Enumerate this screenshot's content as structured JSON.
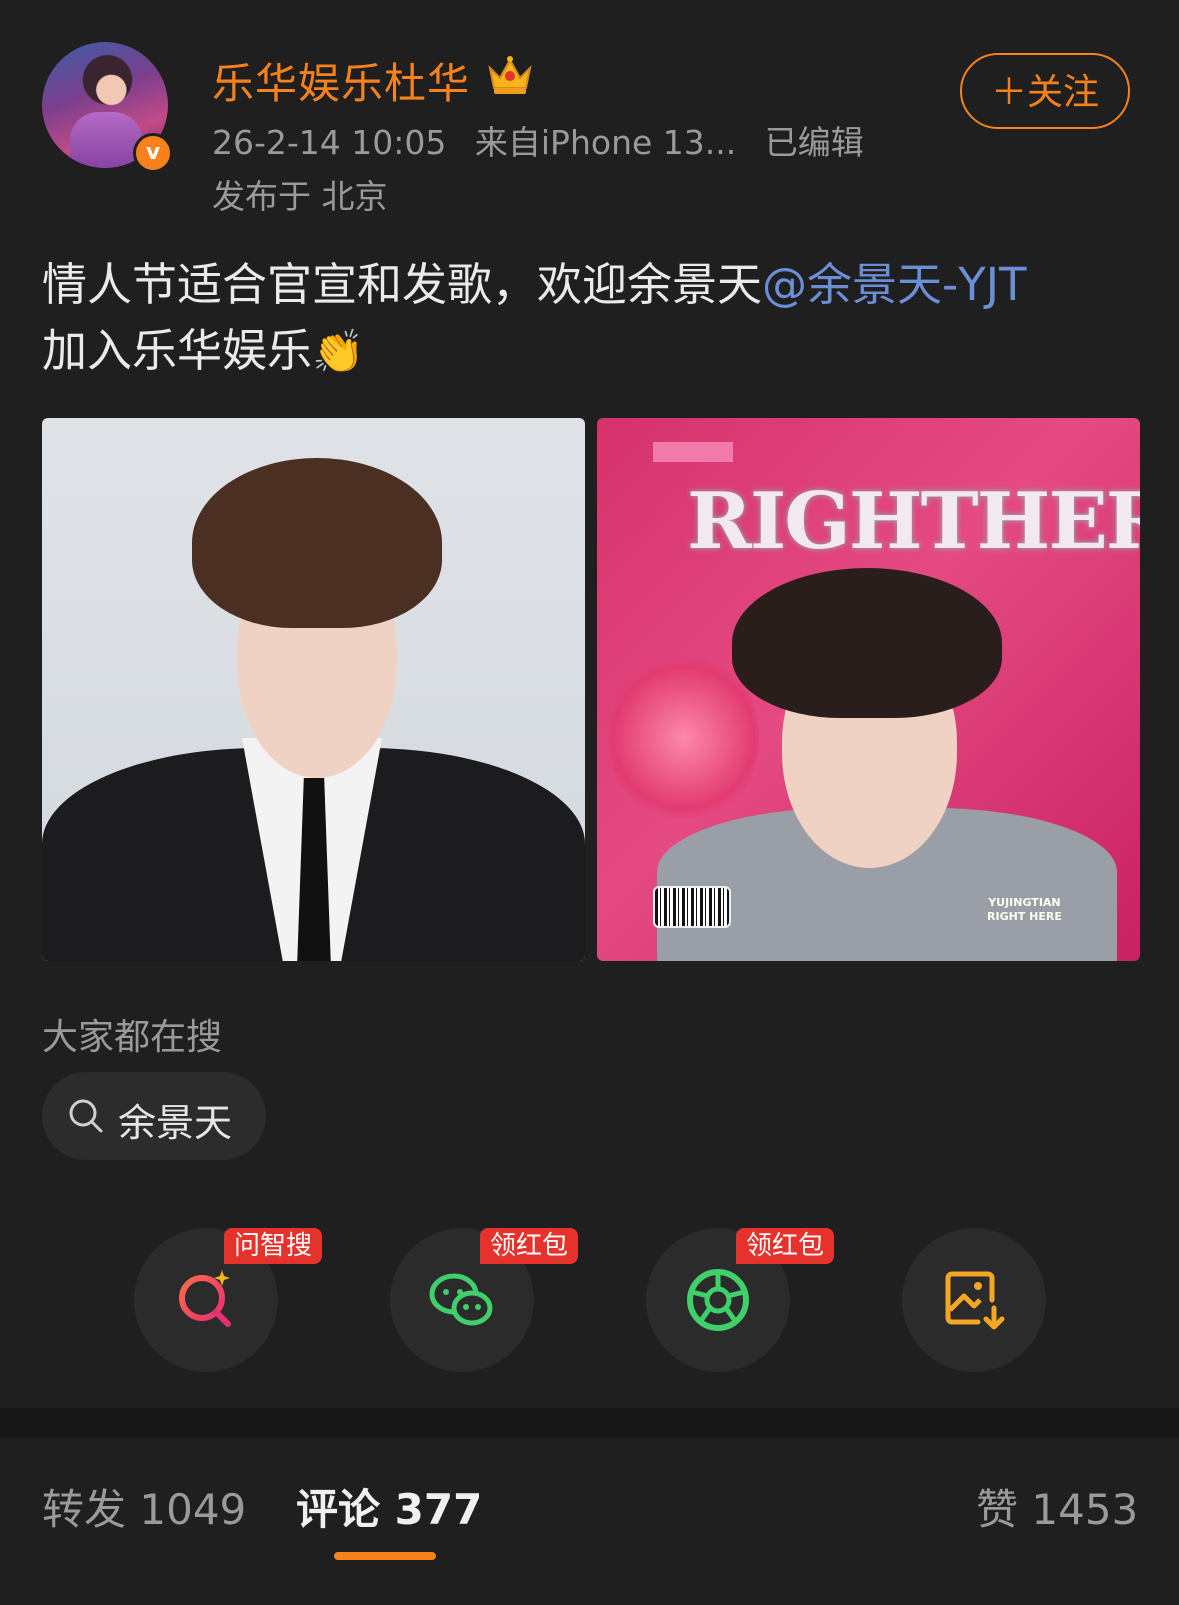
{
  "header": {
    "username": "乐华娱乐杜华",
    "avatar_badge": "v",
    "timestamp": "26-2-14 10:05",
    "source": "来自iPhone 13...",
    "edited": "已编辑",
    "location": "发布于 北京",
    "follow_label": "＋关注"
  },
  "post": {
    "text": "情人节适合官宣和发歌，欢迎余景天",
    "mention": "@余景天-YJT",
    "text2": "加入乐华娱乐",
    "emoji": "👏"
  },
  "images": {
    "album_title": "RIGHTHERE",
    "album_small": "YUJINGTIAN\nRIGHT HERE"
  },
  "search": {
    "title": "大家都在搜",
    "chip_label": "余景天"
  },
  "share": {
    "items": [
      {
        "icon": "ai-search-icon",
        "tag": "问智搜"
      },
      {
        "icon": "wechat-icon",
        "tag": "领红包"
      },
      {
        "icon": "moments-icon",
        "tag": "领红包"
      },
      {
        "icon": "save-image-icon",
        "tag": ""
      }
    ]
  },
  "tabs": {
    "repost_label": "转发",
    "repost_count": "1049",
    "comment_label": "评论",
    "comment_count": "377",
    "like_label": "赞",
    "like_count": "1453"
  },
  "colors": {
    "accent": "#f7821b",
    "mention": "#6b8fd6",
    "tag": "#e6322d",
    "background": "#1f1f1f"
  }
}
